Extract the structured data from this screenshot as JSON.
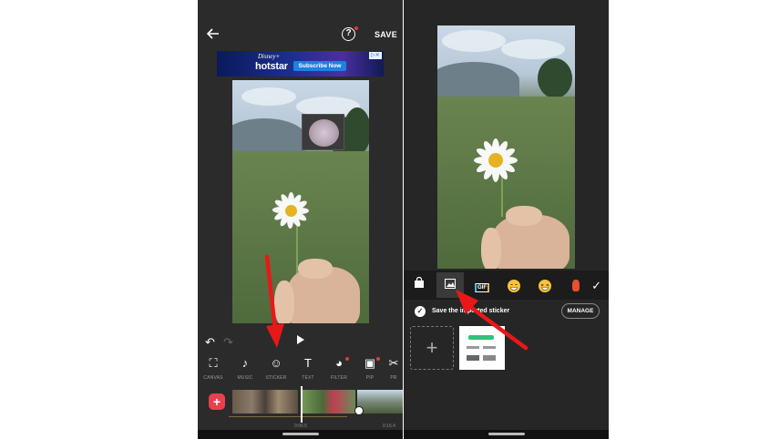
{
  "left_screen": {
    "header": {
      "save_label": "SAVE",
      "help_glyph": "?"
    },
    "ad": {
      "brand_top": "Disney+",
      "brand": "hotstar",
      "cta": "Subscribe Now",
      "ad_mark": "▷✕"
    },
    "toolbar": {
      "items": [
        {
          "label": "CANVAS",
          "icon": "canvas-icon",
          "glyph": "⛶"
        },
        {
          "label": "MUSIC",
          "icon": "music-icon",
          "glyph": "♪"
        },
        {
          "label": "STICKER",
          "icon": "sticker-icon",
          "glyph": "☺"
        },
        {
          "label": "TEXT",
          "icon": "text-icon",
          "glyph": "T"
        },
        {
          "label": "FILTER",
          "icon": "filter-icon",
          "glyph": "◕"
        },
        {
          "label": "PIP",
          "icon": "pip-icon",
          "glyph": "▣"
        },
        {
          "label": "PR",
          "icon": "precut-icon",
          "glyph": "✂"
        }
      ]
    },
    "timeline": {
      "current_time": "0:06.5",
      "total_time": "0:15.4",
      "add_glyph": "+"
    }
  },
  "right_screen": {
    "sticker_tabs": [
      {
        "icon": "shopping-bag-icon",
        "glyph": "🛍"
      },
      {
        "icon": "image-icon",
        "glyph": "▣",
        "active": true
      },
      {
        "icon": "gif-icon",
        "glyph": "GIF"
      },
      {
        "icon": "emoji-grin-icon",
        "glyph": ""
      },
      {
        "icon": "emoji-laugh-icon",
        "glyph": ""
      },
      {
        "icon": "emoji-hand-icon",
        "glyph": "✋"
      }
    ],
    "confirm_glyph": "✓",
    "save_row": {
      "label": "Save the imported sticker",
      "manage_label": "MANAGE",
      "checked": true
    },
    "add_sticker_glyph": "+"
  },
  "colors": {
    "accent_red": "#e53935",
    "add_button": "#e7414d",
    "dark_bg": "#2b2b2b"
  }
}
